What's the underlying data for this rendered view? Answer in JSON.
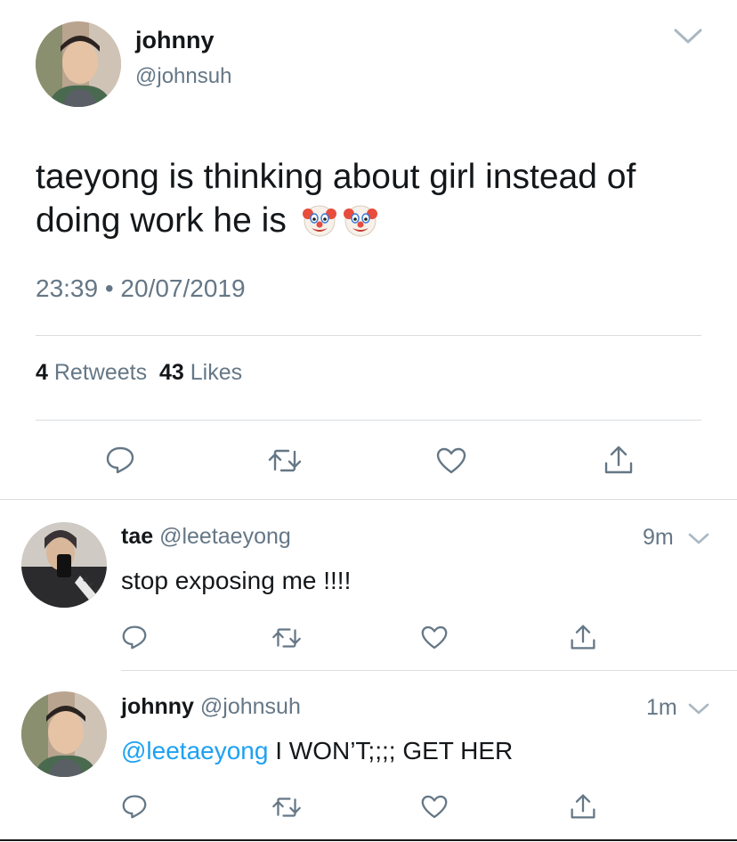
{
  "main_tweet": {
    "author_name": "johnny",
    "author_handle": "@johnsuh",
    "text": "taeyong is thinking about girl instead of doing work he is",
    "emojis": [
      "clown-face",
      "clown-face"
    ],
    "timestamp": "23:39 • 20/07/2019",
    "retweets_count": "4",
    "retweets_label": "Retweets",
    "likes_count": "43",
    "likes_label": "Likes"
  },
  "replies": [
    {
      "author_name": "tae",
      "author_handle": "@leetaeyong",
      "time": "9m",
      "text": "stop exposing me !!!!"
    },
    {
      "author_name": "johnny",
      "author_handle": "@johnsuh",
      "time": "1m",
      "mention": "@leetaeyong",
      "text": " I WON’T;;;; GET HER"
    }
  ],
  "colors": {
    "text": "#14171a",
    "muted": "#657786",
    "link": "#1da1f2",
    "divider": "#d9dde0"
  }
}
